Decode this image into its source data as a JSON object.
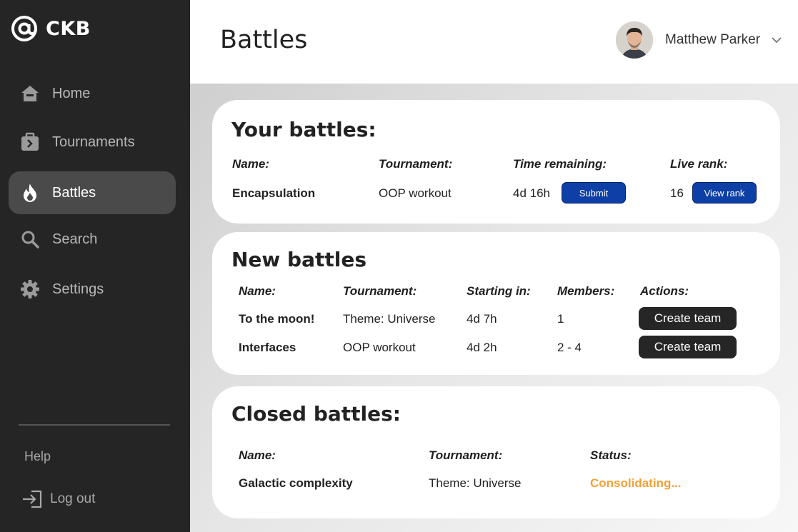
{
  "brand": {
    "name": "CKB"
  },
  "nav": {
    "items": [
      {
        "label": "Home",
        "icon": "home-icon"
      },
      {
        "label": "Tournaments",
        "icon": "briefcase-icon"
      },
      {
        "label": "Battles",
        "icon": "flame-icon",
        "active": true
      },
      {
        "label": "Search",
        "icon": "search-icon"
      },
      {
        "label": "Settings",
        "icon": "gear-icon"
      }
    ],
    "help": "Help",
    "logout": "Log out"
  },
  "header": {
    "title": "Battles",
    "user_name": "Matthew Parker"
  },
  "your_battles": {
    "title": "Your battles:",
    "columns": [
      "Name:",
      "Tournament:",
      "Time remaining:",
      "Live rank:"
    ],
    "rows": [
      {
        "name": "Encapsulation",
        "tournament": "OOP workout",
        "time_remaining": "4d 16h",
        "submit_label": "Submit",
        "rank": "16",
        "view_rank_label": "View rank"
      }
    ]
  },
  "new_battles": {
    "title": "New battles",
    "columns": [
      "Name:",
      "Tournament:",
      "Starting in:",
      "Members:",
      "Actions:"
    ],
    "rows": [
      {
        "name": "To the moon!",
        "tournament": "Theme: Universe",
        "starting_in": "4d 7h",
        "members": "1",
        "action_label": "Create team"
      },
      {
        "name": "Interfaces",
        "tournament": "OOP workout",
        "starting_in": "4d 2h",
        "members": "2 - 4",
        "action_label": "Create team"
      }
    ]
  },
  "closed_battles": {
    "title": "Closed battles:",
    "columns": [
      "Name:",
      "Tournament:",
      "Status:"
    ],
    "rows": [
      {
        "name": "Galactic complexity",
        "tournament": "Theme: Universe",
        "status": "Consolidating...",
        "status_color": "#f5a030"
      }
    ]
  },
  "colors": {
    "sidebar_bg": "#252525",
    "active_nav_bg": "#4a4a4a",
    "primary_button": "#0d3fa6",
    "dark_button": "#262626",
    "status_orange": "#f5a030"
  }
}
